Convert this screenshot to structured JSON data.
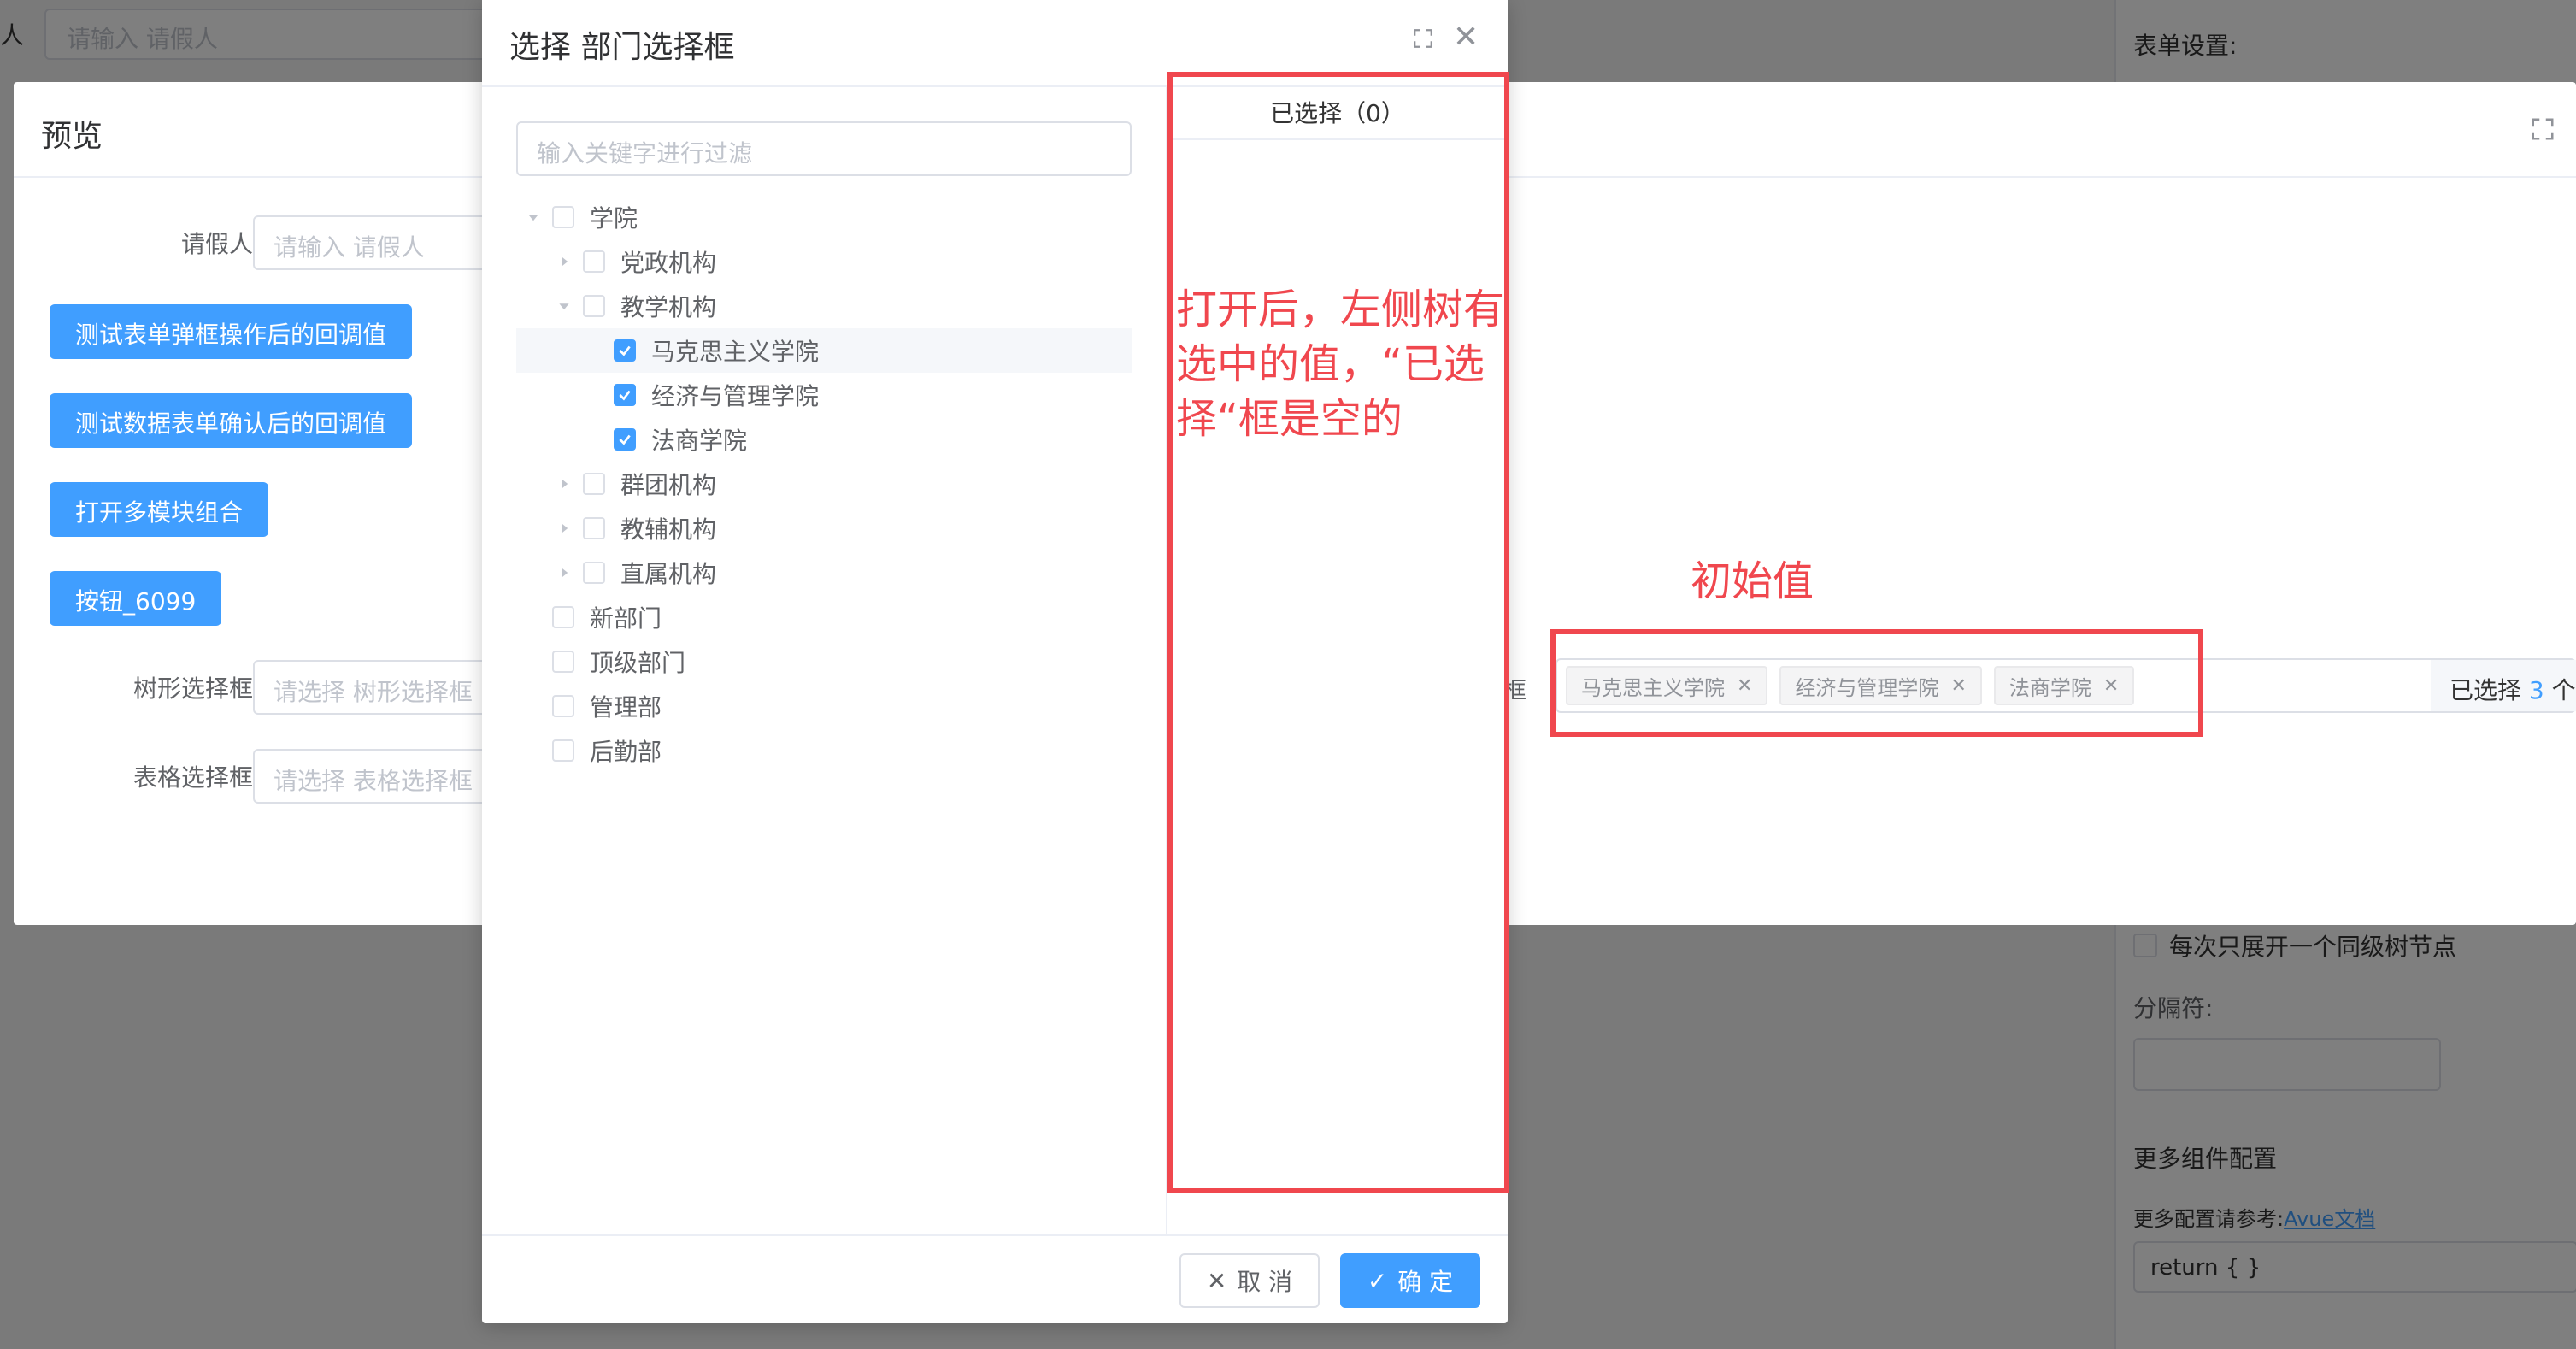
{
  "background": {
    "top_label": "人",
    "top_input_placeholder": "请输入 请假人",
    "right_panel": {
      "title": "表单设置:",
      "check_label": "每次只展开一个同级树节点",
      "separator_label": "分隔符:",
      "more_title": "更多组件配置",
      "more_ref_prefix": "更多配置请参考:",
      "more_ref_link": "Avue文档",
      "code_value": "return { }"
    }
  },
  "preview": {
    "title": "预览",
    "fields": {
      "leave_person_label": "请假人",
      "leave_person_placeholder": "请输入 请假人",
      "tree_select_label": "树形选择框",
      "tree_select_placeholder": "请选择 树形选择框",
      "table_select_label": "表格选择框",
      "table_select_placeholder": "请选择 表格选择框",
      "dept_label_fragment": "框"
    },
    "buttons": [
      "测试表单弹框操作后的回调值",
      "测试数据表单确认后的回调值",
      "打开多模块组合",
      "按钮_6099"
    ],
    "tags": [
      "马克思主义学院",
      "经济与管理学院",
      "法商学院"
    ],
    "selected_count_prefix": "已选择",
    "selected_count_number": "3",
    "selected_count_suffix": "个"
  },
  "dialog": {
    "title": "选择 部门选择框",
    "filter_placeholder": "输入关键字进行过滤",
    "tree": [
      {
        "label": "学院",
        "level": 0,
        "caret": "down",
        "checked": false
      },
      {
        "label": "党政机构",
        "level": 1,
        "caret": "right",
        "checked": false
      },
      {
        "label": "教学机构",
        "level": 1,
        "caret": "down",
        "checked": false
      },
      {
        "label": "马克思主义学院",
        "level": 2,
        "caret": "none",
        "checked": true
      },
      {
        "label": "经济与管理学院",
        "level": 2,
        "caret": "none",
        "checked": true
      },
      {
        "label": "法商学院",
        "level": 2,
        "caret": "none",
        "checked": true
      },
      {
        "label": "群团机构",
        "level": 1,
        "caret": "right",
        "checked": false
      },
      {
        "label": "教辅机构",
        "level": 1,
        "caret": "right",
        "checked": false
      },
      {
        "label": "直属机构",
        "level": 1,
        "caret": "right",
        "checked": false
      },
      {
        "label": "新部门",
        "level": 0,
        "caret": "none",
        "checked": false
      },
      {
        "label": "顶级部门",
        "level": 0,
        "caret": "none",
        "checked": false
      },
      {
        "label": "管理部",
        "level": 0,
        "caret": "none",
        "checked": false
      },
      {
        "label": "后勤部",
        "level": 0,
        "caret": "none",
        "checked": false
      }
    ],
    "selected_header": "已选择（0）",
    "cancel_label": "取 消",
    "ok_label": "确 定"
  },
  "annotations": {
    "left_note": "打开后，左侧树有选中的值，“已选择“框是空的",
    "initial_value_note": "初始值"
  },
  "colors": {
    "primary": "#409eff",
    "annotation_red": "#f0474e"
  }
}
